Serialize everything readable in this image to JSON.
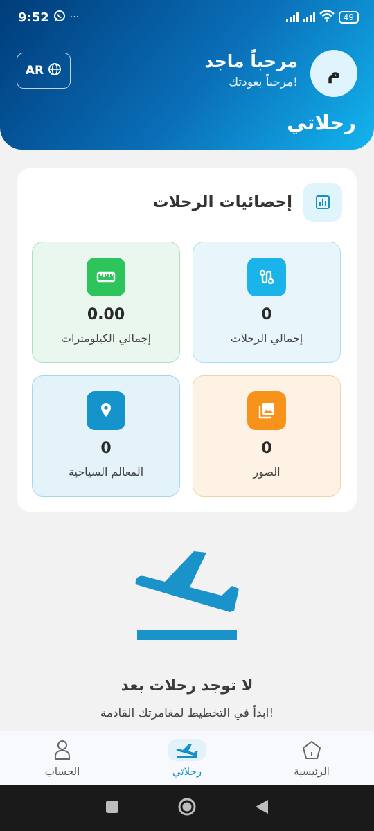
{
  "status_bar": {
    "time": "9:52",
    "dots": "···",
    "battery": "49"
  },
  "header": {
    "lang_label": "AR",
    "avatar_letter": "م",
    "user_greeting": "مرحباً ماجد",
    "welcome_back": "مرحباً بعودتك!",
    "page_title": "رحلاتي"
  },
  "stats": {
    "title": "إحصائيات الرحلات",
    "tiles": [
      {
        "value": "0",
        "label": "إجمالي الرحلات",
        "color": "#1ab3ea"
      },
      {
        "value": "0.00",
        "label": "إجمالي الكيلومترات",
        "color": "#2ec45c"
      },
      {
        "value": "0",
        "label": "الصور",
        "color": "#f7931a"
      },
      {
        "value": "0",
        "label": "المعالم السياحية",
        "color": "#1594cc"
      }
    ]
  },
  "empty_state": {
    "title": "لا توجد رحلات بعد",
    "subtitle": "ابدأ في التخطيط لمغامرتك القادمة!"
  },
  "bottom_nav": {
    "home": "الرئيسية",
    "trips": "رحلاتي",
    "account": "الحساب"
  },
  "colors": {
    "accent": "#1590c6",
    "header_dark": "#003c7a",
    "header_light": "#13b4ef"
  }
}
